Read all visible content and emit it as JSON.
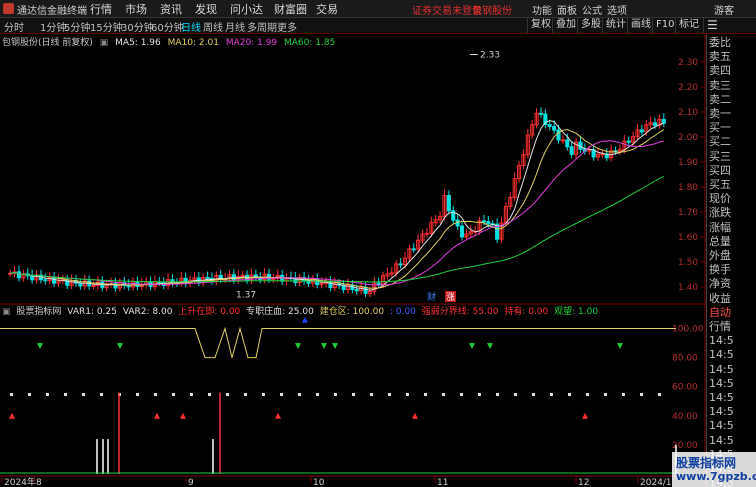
{
  "titlebar": {
    "app_name": "通达信金融终端",
    "menus": [
      "行情",
      "市场",
      "资讯",
      "发现",
      "问小达",
      "财富圈",
      "交易"
    ],
    "alert": "证券交易未登录",
    "alert_link": "包钢股份",
    "right_menus": [
      "功能",
      "面板",
      "公式",
      "选项"
    ],
    "login": "游客"
  },
  "periods": [
    "分时",
    "1分钟",
    "5分钟",
    "15分钟",
    "30分钟",
    "60分钟",
    "日线",
    "周线",
    "月线",
    "多周期",
    "更多"
  ],
  "active_period": "日线",
  "tools": [
    "复权",
    "叠加",
    "多股",
    "统计",
    "画线",
    "F10",
    "标记"
  ],
  "main_chart": {
    "stock_label": "包钢股份(日线 前复权)",
    "ma5": "MA5: 1.96",
    "ma10": "MA10: 2.01",
    "ma20": "MA20: 1.99",
    "ma60": "MA60: 1.85",
    "high_label": "2.33",
    "low_label": "1.37",
    "marker_cai": "财",
    "marker_zhang": "涨"
  },
  "sub_chart": {
    "indicator_name": "股票指标网",
    "var1": "VAR1: 0.25",
    "var2": "VAR2: 8.00",
    "shangsheng": "上升在即: 0.00",
    "zhuangdi": "专职庄血: 25.00",
    "jiancang": "建仓区: 100.00",
    "v0": ": 0.00",
    "qiangruo": "强弱分界线: 55.00",
    "chiyou": "持有: 0.00",
    "guanwang": "观望: 1.00"
  },
  "x_labels": [
    "2024年",
    "8",
    "9",
    "10",
    "11",
    "12",
    "2024/1"
  ],
  "right_panel": [
    {
      "t": "委比",
      "c": "cyan"
    },
    {
      "t": "卖五",
      "c": "cyan"
    },
    {
      "t": "卖四",
      "c": "cyan"
    },
    {
      "t": "卖三",
      "c": "cyan"
    },
    {
      "t": "卖二",
      "c": "cyan"
    },
    {
      "t": "卖一",
      "c": "cyan"
    },
    {
      "t": "买一",
      "c": "cyan"
    },
    {
      "t": "买二",
      "c": "cyan"
    },
    {
      "t": "买三",
      "c": "cyan"
    },
    {
      "t": "买四",
      "c": "cyan"
    },
    {
      "t": "买五",
      "c": "cyan"
    },
    {
      "t": "现价",
      "c": "cyan"
    },
    {
      "t": "涨跌",
      "c": "cyan"
    },
    {
      "t": "涨幅",
      "c": "cyan"
    },
    {
      "t": "总量",
      "c": "cyan"
    },
    {
      "t": "外盘",
      "c": "cyan"
    },
    {
      "t": "换手",
      "c": "cyan"
    },
    {
      "t": "净资",
      "c": "cyan"
    },
    {
      "t": "收益",
      "c": "cyan"
    },
    {
      "t": "自动",
      "c": "red"
    },
    {
      "t": "行情",
      "c": "cyan"
    },
    {
      "t": "14:5",
      "c": "cyan"
    },
    {
      "t": "14:5",
      "c": "cyan"
    },
    {
      "t": "14:5",
      "c": "cyan"
    },
    {
      "t": "14:5",
      "c": "cyan"
    },
    {
      "t": "14:5",
      "c": "cyan"
    },
    {
      "t": "14:5",
      "c": "cyan"
    },
    {
      "t": "14:5",
      "c": "cyan"
    },
    {
      "t": "14:5",
      "c": "cyan"
    },
    {
      "t": "14:5",
      "c": "cyan"
    },
    {
      "t": "14:5",
      "c": "cyan"
    },
    {
      "t": "14:5",
      "c": "cyan"
    }
  ],
  "watermark": {
    "line1": "股票指标网",
    "line2": "www.7gpzb.com"
  },
  "chart_data": {
    "type": "candlestick",
    "y_ticks": [
      "2.30",
      "2.20",
      "2.10",
      "2.00",
      "1.90",
      "1.80",
      "1.70",
      "1.60",
      "1.50",
      "1.40"
    ],
    "ylim": [
      1.34,
      2.38
    ],
    "sub_y_ticks": [
      "100.00",
      "80.00",
      "60.00",
      "40.00",
      "20.00"
    ],
    "sub_ylim": [
      0,
      110
    ],
    "colors": {
      "up": "#ff3030",
      "down": "#00e0e0",
      "ma5": "#e0e0e0",
      "ma10": "#e0d060",
      "ma20": "#e040e0",
      "ma60": "#20d040"
    }
  }
}
